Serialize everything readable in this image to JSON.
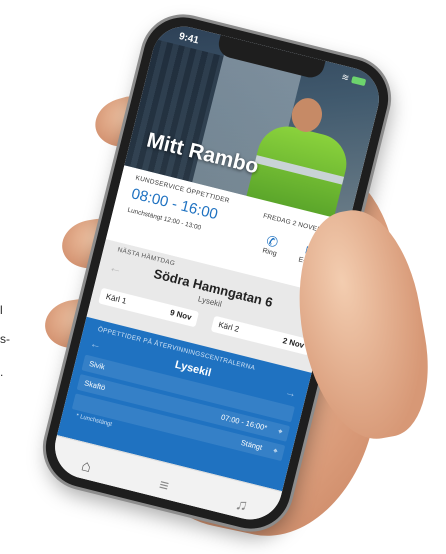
{
  "scene_text": {
    "frag1": "l",
    "frag2": "s-",
    "frag3": "."
  },
  "status_bar": {
    "time": "9:41",
    "wifi_icon": "wifi-icon"
  },
  "header": {
    "title": "Mitt Rambo"
  },
  "customer_service": {
    "label": "KUNDSERVICE ÖPPETTIDER",
    "hours": "08:00 - 16:00",
    "lunch": "Lunchstängt 12:00 - 13:00",
    "date": "FREDAG 2 NOVEMBER",
    "call_label": "Ring",
    "email_label": "E-post"
  },
  "next_pickup": {
    "label": "NÄSTA HÄMTDAG",
    "address": "Södra Hamngatan 6",
    "city": "Lysekil",
    "bins": [
      {
        "name": "Kärl 1",
        "date": "9 Nov"
      },
      {
        "name": "Kärl 2",
        "date": "2 Nov"
      }
    ]
  },
  "recycling": {
    "label": "ÖPPETTIDER PÅ ÅTERVINNINGSCENTRALERNA",
    "city": "Lysekil",
    "rows": [
      {
        "name": "Sivik",
        "value": ""
      },
      {
        "name": "Skaftö",
        "value": "07:00 - 16:00*"
      },
      {
        "name": "",
        "value": "Stängt"
      }
    ],
    "note": "* Lunchstängt"
  },
  "nav": {
    "home_icon": "home-icon",
    "menu_icon": "menu-icon",
    "bell_icon": "bell-icon"
  },
  "colors": {
    "brand_blue": "#1f72c1",
    "vest_green": "#8ad23c"
  }
}
